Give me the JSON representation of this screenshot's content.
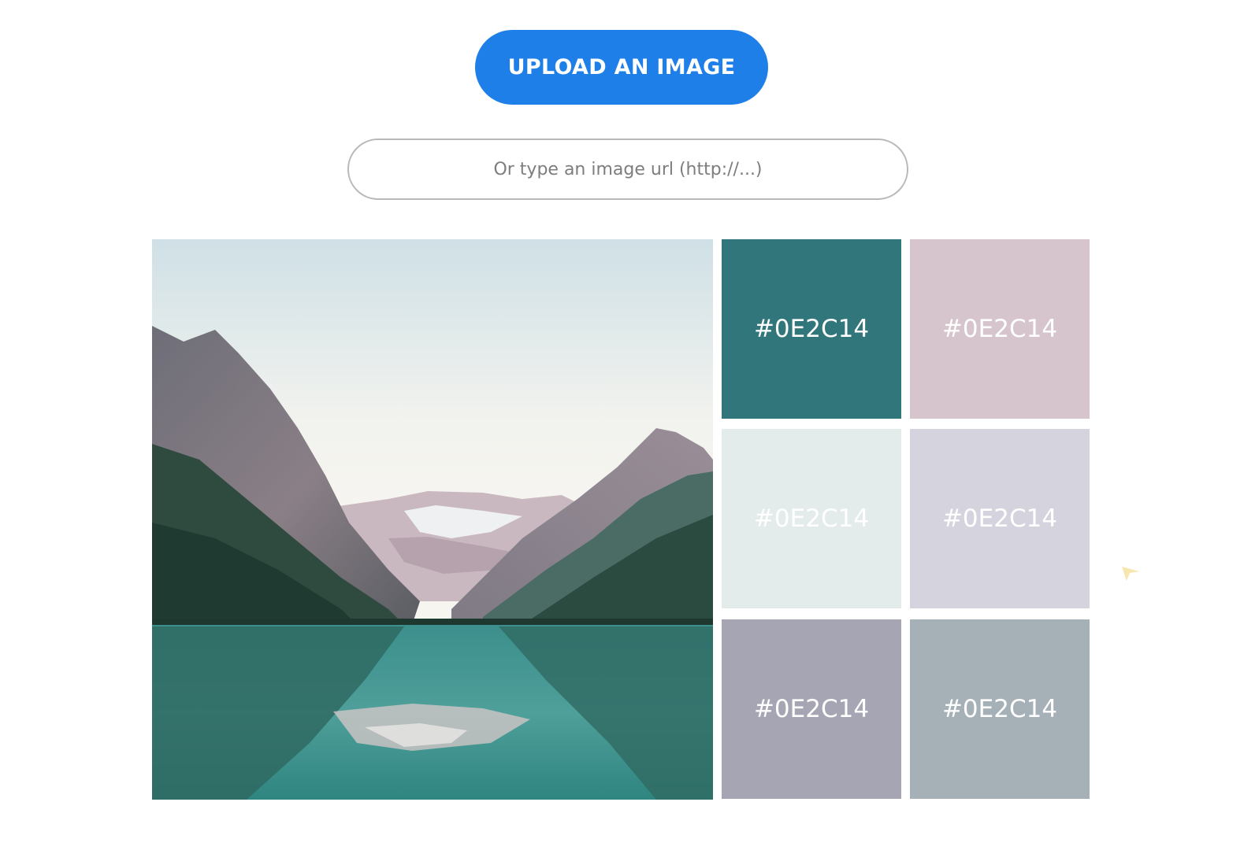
{
  "upload": {
    "label": "UPLOAD AN IMAGE",
    "color": "#1e7fe9"
  },
  "url_input": {
    "placeholder": "Or type an image url (http://...)",
    "value": ""
  },
  "photo": {
    "subject": "mountain lake landscape photo"
  },
  "swatches": [
    {
      "label": "#0E2C14",
      "color": "#31767a"
    },
    {
      "label": "#0E2C14",
      "color": "#d6c5cc"
    },
    {
      "label": "#0E2C14",
      "color": "#e3eceb"
    },
    {
      "label": "#0E2C14",
      "color": "#d5d3dd"
    },
    {
      "label": "#0E2C14",
      "color": "#a6a5b3"
    },
    {
      "label": "#0E2C14",
      "color": "#a6b0b7"
    }
  ]
}
